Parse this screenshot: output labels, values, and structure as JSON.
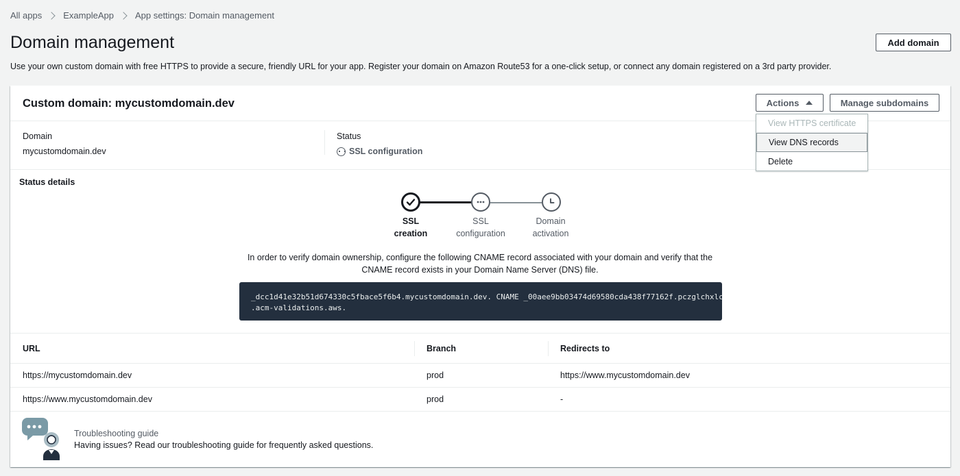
{
  "breadcrumb": {
    "items": [
      "All apps",
      "ExampleApp",
      "App settings: Domain management"
    ]
  },
  "page": {
    "title": "Domain management",
    "description": "Use your own custom domain with free HTTPS to provide a secure, friendly URL for your app. Register your domain on Amazon Route53 for a one-click setup, or connect any domain registered on a 3rd party provider.",
    "add_domain_label": "Add domain"
  },
  "card": {
    "title": "Custom domain: mycustomdomain.dev",
    "actions_label": "Actions",
    "manage_subdomains_label": "Manage subdomains",
    "actions_menu": {
      "view_https": "View HTTPS certificate",
      "view_dns": "View DNS records",
      "delete": "Delete"
    },
    "domain_label": "Domain",
    "domain_value": "mycustomdomain.dev",
    "status_label": "Status",
    "status_value": "SSL configuration",
    "status_details_label": "Status details"
  },
  "stepper": {
    "steps": [
      {
        "line1": "SSL",
        "line2": "creation",
        "state": "complete",
        "icon": "check-icon"
      },
      {
        "line1": "SSL",
        "line2": "configuration",
        "state": "in-progress",
        "icon": "pending-icon"
      },
      {
        "line1": "Domain",
        "line2": "activation",
        "state": "pending",
        "icon": "clock-icon"
      }
    ]
  },
  "verification": {
    "text": "In order to verify domain ownership, configure the following CNAME record associated with your domain and verify that the CNAME record exists in your Domain Name Server (DNS) file.",
    "code_line1": "_dcc1d41e32b51d674330c5fbace5f6b4.mycustomdomain.dev. CNAME _00aee9bb03474d69580cda438f77162f.pczglchxlc",
    "code_line2": ".acm-validations.aws."
  },
  "table": {
    "headers": {
      "url": "URL",
      "branch": "Branch",
      "redirects": "Redirects to"
    },
    "rows": [
      {
        "url": "https://mycustomdomain.dev",
        "branch": "prod",
        "redirects": "https://www.mycustomdomain.dev"
      },
      {
        "url": "https://www.mycustomdomain.dev",
        "branch": "prod",
        "redirects": "-"
      }
    ]
  },
  "troubleshooting": {
    "title": "Troubleshooting guide",
    "description": "Having issues? Read our troubleshooting guide for frequently asked questions."
  },
  "colors": {
    "page_bg": "#f2f3f3",
    "code_bg": "#232f3e",
    "text_primary": "#16191f",
    "text_secondary": "#545b64",
    "step_complete": "#16191f",
    "step_pending": "#545b64"
  }
}
